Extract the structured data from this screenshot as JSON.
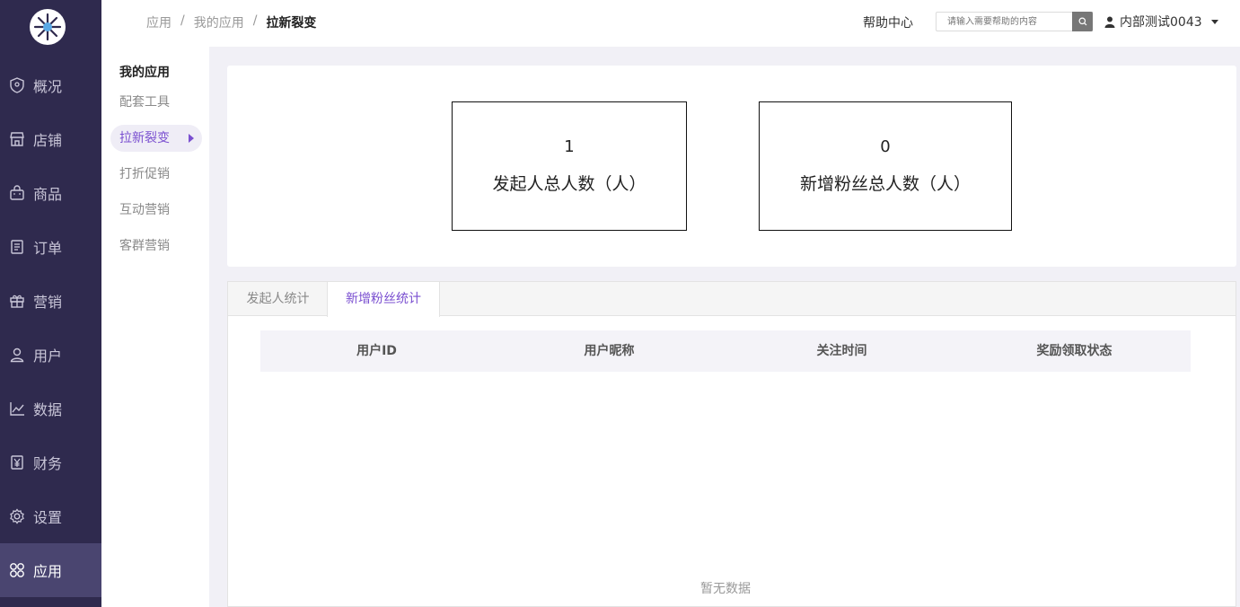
{
  "header": {
    "breadcrumb": [
      "应用",
      "我的应用",
      "拉新裂变"
    ],
    "separator": "/",
    "help_label": "帮助中心",
    "search_placeholder": "请输入需要帮助的内容",
    "user_name": "内部测试0043"
  },
  "sidebar": {
    "items": [
      {
        "label": "概况",
        "icon": "shield-icon"
      },
      {
        "label": "店铺",
        "icon": "store-icon"
      },
      {
        "label": "商品",
        "icon": "bag-icon"
      },
      {
        "label": "订单",
        "icon": "document-icon"
      },
      {
        "label": "营销",
        "icon": "gift-icon"
      },
      {
        "label": "用户",
        "icon": "user-icon"
      },
      {
        "label": "数据",
        "icon": "chart-line-icon"
      },
      {
        "label": "财务",
        "icon": "yen-icon"
      },
      {
        "label": "设置",
        "icon": "gear-icon"
      },
      {
        "label": "应用",
        "icon": "apps-icon"
      }
    ],
    "active": "应用"
  },
  "submenu": {
    "title": "我的应用",
    "items": [
      "配套工具",
      "拉新裂变",
      "打折促销",
      "互动营销",
      "客群营销"
    ],
    "active": "拉新裂变"
  },
  "stats": [
    {
      "value": "1",
      "label": "发起人总人数（人）"
    },
    {
      "value": "0",
      "label": "新增粉丝总人数（人）"
    }
  ],
  "tabs": [
    "发起人统计",
    "新增粉丝统计"
  ],
  "active_tab": "新增粉丝统计",
  "table": {
    "columns": [
      "用户ID",
      "用户昵称",
      "关注时间",
      "奖励领取状态"
    ],
    "empty_text": "暂无数据"
  },
  "colors": {
    "sidebar_bg": "#2f2a4e",
    "accent": "#7a4fd0"
  }
}
